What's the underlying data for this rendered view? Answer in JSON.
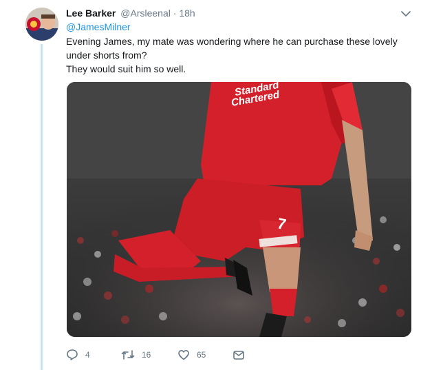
{
  "tweet": {
    "author": {
      "display_name": "Lee Barker",
      "handle": "@Arsleenal",
      "dot": "·",
      "time": "18h"
    },
    "reply_to": "@JamesMilner",
    "text_lines": [
      "Evening James, my mate was wondering where he can purchase these lovely under shorts from?",
      "They would suit him so well."
    ],
    "media": {
      "shirt_text_line1": "Standard",
      "shirt_text_line2": "Chartered",
      "shorts_number": "7",
      "colors": {
        "kit_red": "#d3202a",
        "crowd_dark": "#2b2b2b"
      }
    },
    "actions": {
      "reply_icon": "reply-icon",
      "reply_count": "4",
      "retweet_icon": "retweet-icon",
      "retweet_count": "16",
      "like_icon": "heart-icon",
      "like_count": "65",
      "dm_icon": "envelope-icon"
    },
    "colors": {
      "link": "#1b95e0",
      "muted": "#657786",
      "thread_line": "#c4e6f3"
    }
  }
}
